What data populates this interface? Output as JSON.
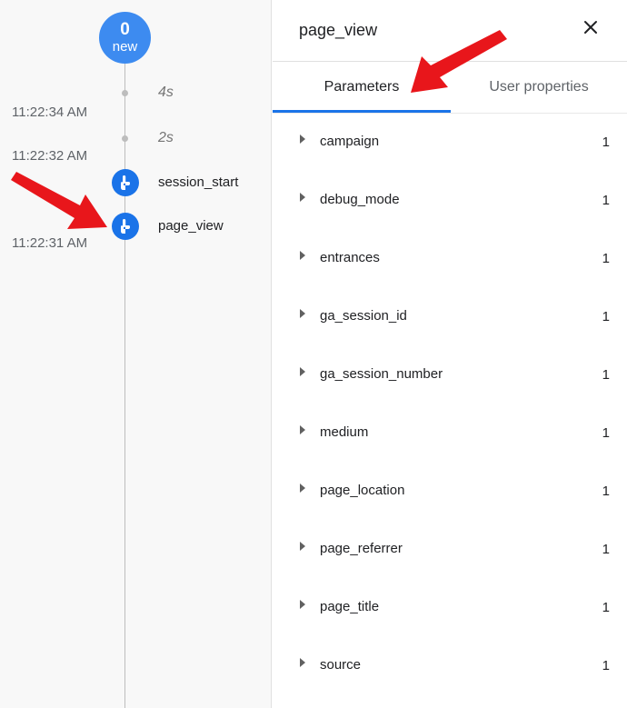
{
  "timeline": {
    "new_badge": {
      "count": "0",
      "label": "new"
    },
    "gaps": [
      {
        "label": "4s"
      },
      {
        "label": "2s"
      }
    ],
    "times": [
      "11:22:34 AM",
      "11:22:32 AM",
      "11:22:31 AM"
    ],
    "events": [
      {
        "name": "session_start",
        "icon": "touch-icon"
      },
      {
        "name": "page_view",
        "icon": "touch-icon"
      }
    ]
  },
  "detail": {
    "title": "page_view",
    "close_icon": "close-icon",
    "tabs": [
      {
        "label": "Parameters",
        "active": true
      },
      {
        "label": "User properties",
        "active": false
      }
    ],
    "parameters": [
      {
        "name": "campaign",
        "count": "1"
      },
      {
        "name": "debug_mode",
        "count": "1"
      },
      {
        "name": "entrances",
        "count": "1"
      },
      {
        "name": "ga_session_id",
        "count": "1"
      },
      {
        "name": "ga_session_number",
        "count": "1"
      },
      {
        "name": "medium",
        "count": "1"
      },
      {
        "name": "page_location",
        "count": "1"
      },
      {
        "name": "page_referrer",
        "count": "1"
      },
      {
        "name": "page_title",
        "count": "1"
      },
      {
        "name": "source",
        "count": "1"
      }
    ]
  },
  "colors": {
    "accent": "#1a73e8",
    "badge": "#3d8bf0",
    "annotation_arrow": "#e8161b"
  }
}
